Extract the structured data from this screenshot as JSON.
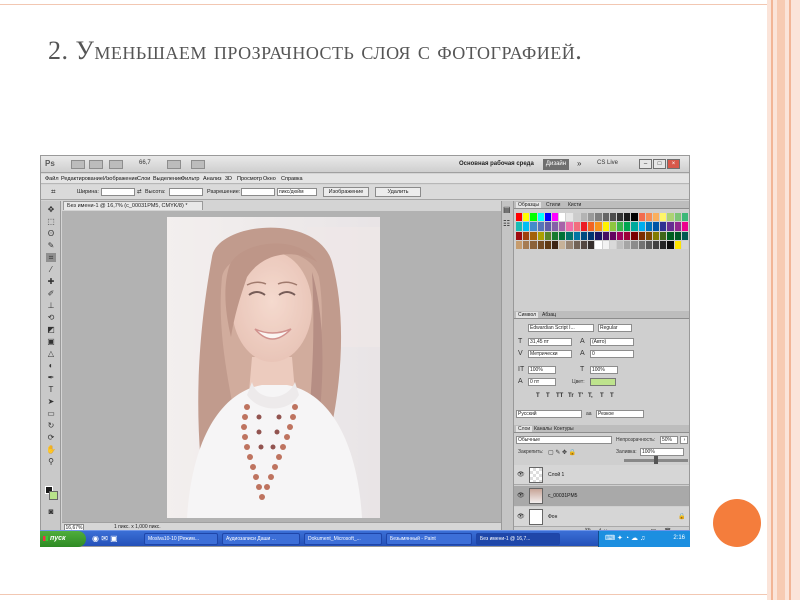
{
  "slide": {
    "title": "2. Уменьшаем прозрачность слоя с фотографией."
  },
  "app": {
    "logo": "Ps",
    "zoom_readout": "66,7",
    "workspace_label": "Основная рабочая среда",
    "workspace_button": "Дизайн",
    "chevron": "»",
    "cslive": "CS Live"
  },
  "menu": {
    "items": [
      "Файл",
      "Редактирование",
      "Изображение",
      "Слои",
      "Выделение",
      "Фильтр",
      "Анализ",
      "3D",
      "Просмотр",
      "Окно",
      "Справка"
    ]
  },
  "options": {
    "width_label": "Ширина:",
    "height_label": "Высота:",
    "resolution_label": "Разрешение:",
    "unit_select": "пикс/дюйм",
    "image_button": "Изображение",
    "delete_button": "Удалить"
  },
  "document": {
    "tab_title": "Без имени-1 @ 16,7% (с_00031РМ5, CMYK/8) *",
    "zoom": "16,67%",
    "doc_info": "1 пикс. x 1,000 пикс."
  },
  "panels": {
    "swatches_tabs": [
      "Образцы",
      "Стили",
      "Кисти"
    ],
    "char_tabs": [
      "Символ",
      "Абзац"
    ],
    "font_family": "Edwardian Script I...",
    "font_style": "Regular",
    "font_size": "31,45 пт",
    "leading": "(Авто)",
    "kerning": "Метрически",
    "tracking": "0",
    "vscale": "100%",
    "hscale": "100%",
    "baseline": "0 пт",
    "color_label": "Цвет:",
    "format_buttons": [
      "T",
      "T",
      "TT",
      "Tr",
      "T'",
      "T,",
      "T",
      "T"
    ],
    "language": "Русский",
    "aa_mode": "Резкое",
    "aa_prefix": "aa",
    "layers_tabs": [
      "Слои",
      "Каналы",
      "Контуры"
    ],
    "blend_mode": "Обычные",
    "opacity_label": "Непрозрачность:",
    "opacity_value": "50%",
    "opacity_level": 0.5,
    "lock_label": "Закрепить:",
    "fill_label": "Заливка:",
    "fill_value": "100%",
    "layers": [
      {
        "name": "Слой 1",
        "selected": false,
        "locked": false
      },
      {
        "name": "с_00031РМ5",
        "selected": true,
        "locked": false
      },
      {
        "name": "Фон",
        "selected": false,
        "locked": true
      }
    ]
  },
  "taskbar": {
    "start_label": "пуск",
    "tasks": [
      "Moslva10-10 [Режим...",
      "Аудиозаписи Даши ...",
      "Dokument_Microsoft_...",
      "Безымянный - Paint",
      "Без имени-1 @ 16,7..."
    ],
    "clock": "2:16"
  },
  "colors": {
    "accent_orange": "#f47d3c",
    "taskbar_blue": "#2450b8",
    "start_green": "#3c9a2d",
    "bg_swatch_green": "#b8e28a"
  }
}
